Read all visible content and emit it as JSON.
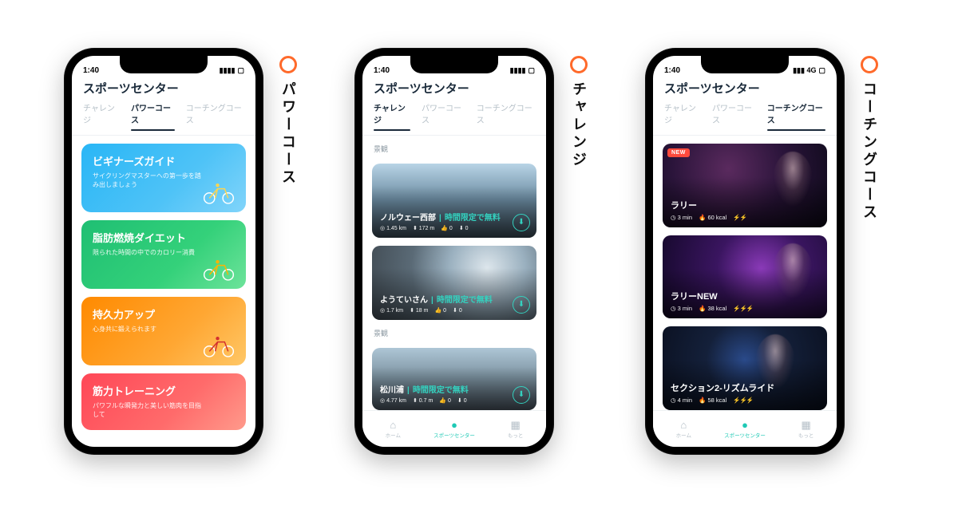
{
  "labels": {
    "power": "パワーコース",
    "challenge": "チャレンジ",
    "coaching": "コーチングコース"
  },
  "common": {
    "time": "1:40",
    "carrier_4g": "4G",
    "title": "スポーツセンター",
    "tabs": {
      "challenge": "チャレンジ",
      "power": "パワーコース",
      "coaching": "コーチングコース"
    },
    "tabbar": {
      "home": "ホーム",
      "center": "スポーツセンター",
      "more": "もっと"
    }
  },
  "power_cards": [
    {
      "title": "ビギナーズガイド",
      "desc": "サイクリングマスターへの第一歩を踏み出しましょう",
      "grad": "linear-gradient(135deg,#29b6f6 0%,#4fc3f7 60%,#81d4fa 100%)"
    },
    {
      "title": "脂肪燃焼ダイエット",
      "desc": "限られた時間の中でのカロリー消費",
      "grad": "linear-gradient(135deg,#1fbf73 0%,#34d17a 60%,#6de39a 100%)"
    },
    {
      "title": "持久力アップ",
      "desc": "心身共に鍛えられます",
      "grad": "linear-gradient(135deg,#ff8a00 0%,#ffa733 60%,#ffc766 100%)"
    },
    {
      "title": "筋力トレーニング",
      "desc": "パワフルな瞬発力と美しい筋肉を目指して",
      "grad": "linear-gradient(135deg,#ff4757 0%,#ff6b6b 60%,#ff9a8b 100%)"
    }
  ],
  "challenge": {
    "section1": "景観",
    "section2": "景観",
    "cards": [
      {
        "name": "ノルウェー西部",
        "free": "時間限定で無料",
        "dist": "1.45 km",
        "elev": "172 m",
        "likes": "0",
        "dl": "0"
      },
      {
        "name": "ようていさん",
        "free": "時間限定で無料",
        "dist": "1.7 km",
        "elev": "18 m",
        "likes": "0",
        "dl": "0"
      },
      {
        "name": "松川浦",
        "free": "時間限定で無料",
        "dist": "4.77 km",
        "elev": "0.7 m",
        "likes": "0",
        "dl": "0"
      }
    ]
  },
  "coaching": {
    "new_badge": "NEW",
    "cards": [
      {
        "title": "ラリー",
        "mins": "3",
        "min_label": "min",
        "kcal": "60",
        "kcal_label": "kcal",
        "bolts": "⚡⚡"
      },
      {
        "title": "ラリーNEW",
        "mins": "3",
        "min_label": "min",
        "kcal": "38",
        "kcal_label": "kcal",
        "bolts": "⚡⚡⚡"
      },
      {
        "title": "セクション2-リズムライド",
        "mins": "4",
        "min_label": "min",
        "kcal": "58",
        "kcal_label": "kcal",
        "bolts": "⚡⚡⚡"
      }
    ]
  }
}
